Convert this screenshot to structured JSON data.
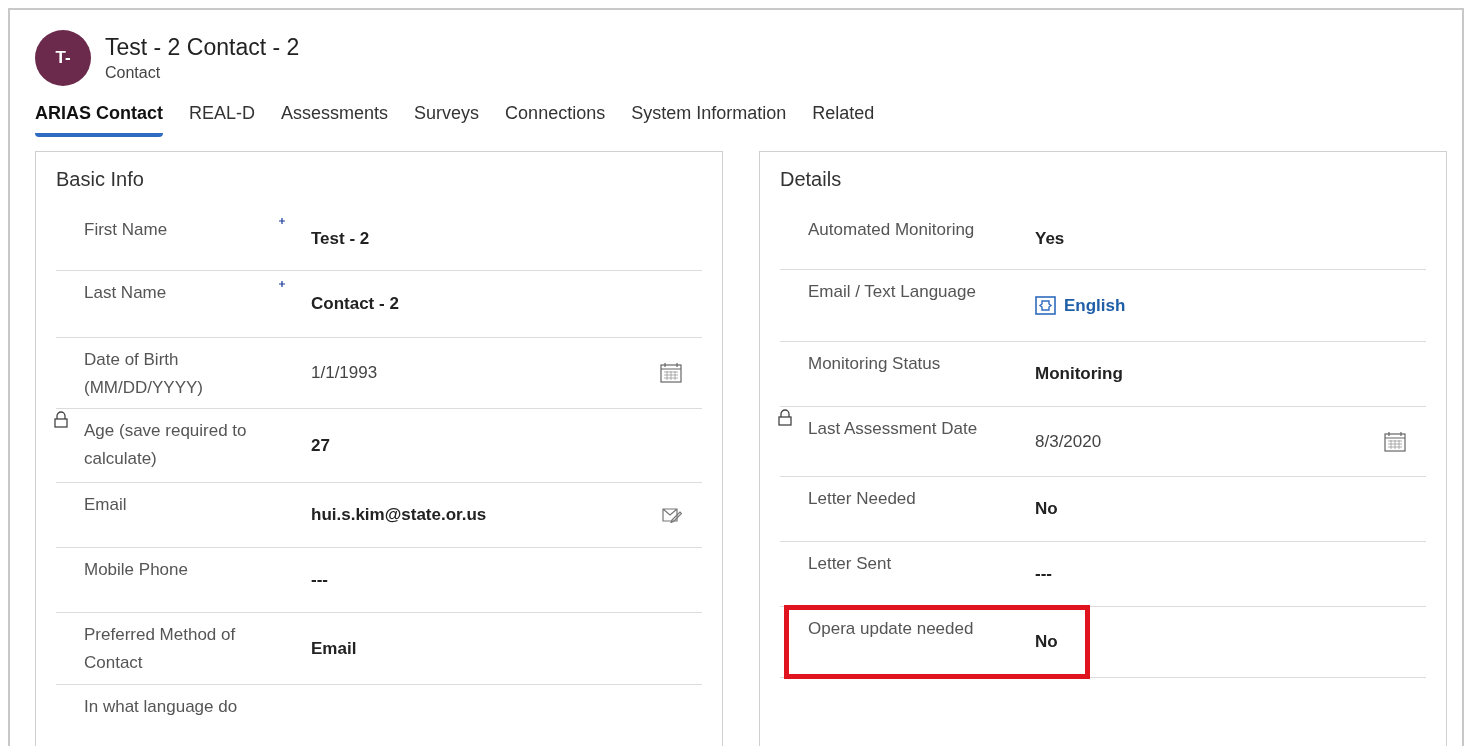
{
  "header": {
    "avatar": "T-",
    "title": "Test - 2 Contact - 2",
    "subtitle": "Contact"
  },
  "tabs": [
    {
      "label": "ARIAS Contact",
      "selected": true
    },
    {
      "label": "REAL-D",
      "selected": false
    },
    {
      "label": "Assessments",
      "selected": false
    },
    {
      "label": "Surveys",
      "selected": false
    },
    {
      "label": "Connections",
      "selected": false
    },
    {
      "label": "System Information",
      "selected": false
    },
    {
      "label": "Related",
      "selected": false
    }
  ],
  "sections": [
    {
      "title": "Basic Info",
      "fields": [
        {
          "label": "First Name",
          "value": "Test - 2",
          "kind": "text",
          "required": true,
          "locked": false,
          "highlighted": false
        },
        {
          "label": "Last Name",
          "value": "Contact - 2",
          "kind": "text",
          "required": true,
          "locked": false,
          "highlighted": false
        },
        {
          "label": "Date of Birth (MM/DD/YYYY)",
          "value": "1/1/1993",
          "kind": "date",
          "required": false,
          "locked": false,
          "highlighted": false
        },
        {
          "label": "Age (save required to calculate)",
          "value": "27",
          "kind": "text",
          "required": false,
          "locked": true,
          "highlighted": false
        },
        {
          "label": "Email",
          "value": "hui.s.kim@state.or.us",
          "kind": "email",
          "required": false,
          "locked": false,
          "highlighted": false
        },
        {
          "label": "Mobile Phone",
          "value": "---",
          "kind": "text",
          "required": false,
          "locked": false,
          "highlighted": false
        },
        {
          "label": "Preferred Method of Contact",
          "value": "Email",
          "kind": "text",
          "required": false,
          "locked": false,
          "highlighted": false
        },
        {
          "label": "In what language do",
          "kind": "text",
          "required": false,
          "locked": false,
          "highlighted": false
        }
      ]
    },
    {
      "title": "Details",
      "fields": [
        {
          "label": "Automated Monitoring",
          "value": "Yes",
          "kind": "text",
          "required": false,
          "locked": false,
          "highlighted": false
        },
        {
          "label": "Email / Text Language",
          "value": "English",
          "kind": "lookup",
          "required": false,
          "locked": false,
          "highlighted": false
        },
        {
          "label": "Monitoring Status",
          "value": "Monitoring",
          "kind": "text",
          "required": false,
          "locked": false,
          "highlighted": false
        },
        {
          "label": "Last Assessment Date",
          "value": "8/3/2020",
          "kind": "date",
          "required": false,
          "locked": true,
          "highlighted": false
        },
        {
          "label": "Letter Needed",
          "value": "No",
          "kind": "text",
          "required": false,
          "locked": false,
          "highlighted": false
        },
        {
          "label": "Letter Sent",
          "value": "---",
          "kind": "text",
          "required": false,
          "locked": false,
          "highlighted": false
        },
        {
          "label": "Opera update needed",
          "value": "No",
          "kind": "text",
          "required": false,
          "locked": false,
          "highlighted": true
        }
      ]
    }
  ]
}
